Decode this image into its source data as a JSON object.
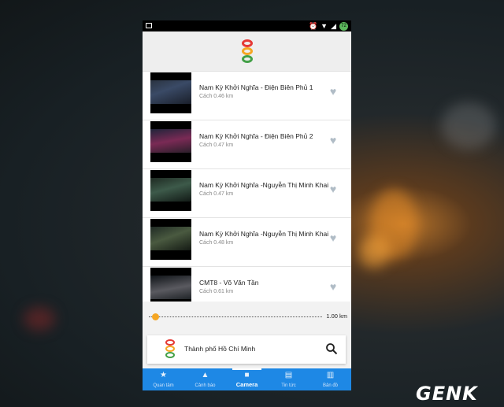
{
  "status_bar": {
    "battery": "72"
  },
  "cameras": [
    {
      "name": "Nam Kỳ Khởi Nghĩa - Điện Biên Phủ 1",
      "distance": "Cách 0.46 km"
    },
    {
      "name": "Nam Kỳ Khởi Nghĩa - Điện Biên Phủ 2",
      "distance": "Cách 0.47 km"
    },
    {
      "name": "Nam Kỳ Khởi Nghĩa -Nguyễn Thị Minh Khai",
      "distance": "Cách 0.47 km"
    },
    {
      "name": "Nam Kỳ Khởi Nghĩa -Nguyễn Thị Minh Khai",
      "distance": "Cách 0.48 km"
    },
    {
      "name": "CMT8 - Võ Văn Tần",
      "distance": "Cách 0.61 km"
    }
  ],
  "radius": {
    "label": "1.00 km",
    "level": 0.05
  },
  "city": {
    "name": "Thành phố Hồ Chí Minh"
  },
  "tabs": [
    {
      "label": "Quan tâm",
      "icon": "star-icon"
    },
    {
      "label": "Cảnh báo",
      "icon": "warning-icon"
    },
    {
      "label": "Camera",
      "icon": "video-camera-icon"
    },
    {
      "label": "Tin tức",
      "icon": "news-icon"
    },
    {
      "label": "Bản đồ",
      "icon": "map-icon"
    }
  ],
  "colors": {
    "accent": "#1e88e5",
    "slider": "#f5a623",
    "heart": "#b0bcc6"
  },
  "watermark": "GENK"
}
